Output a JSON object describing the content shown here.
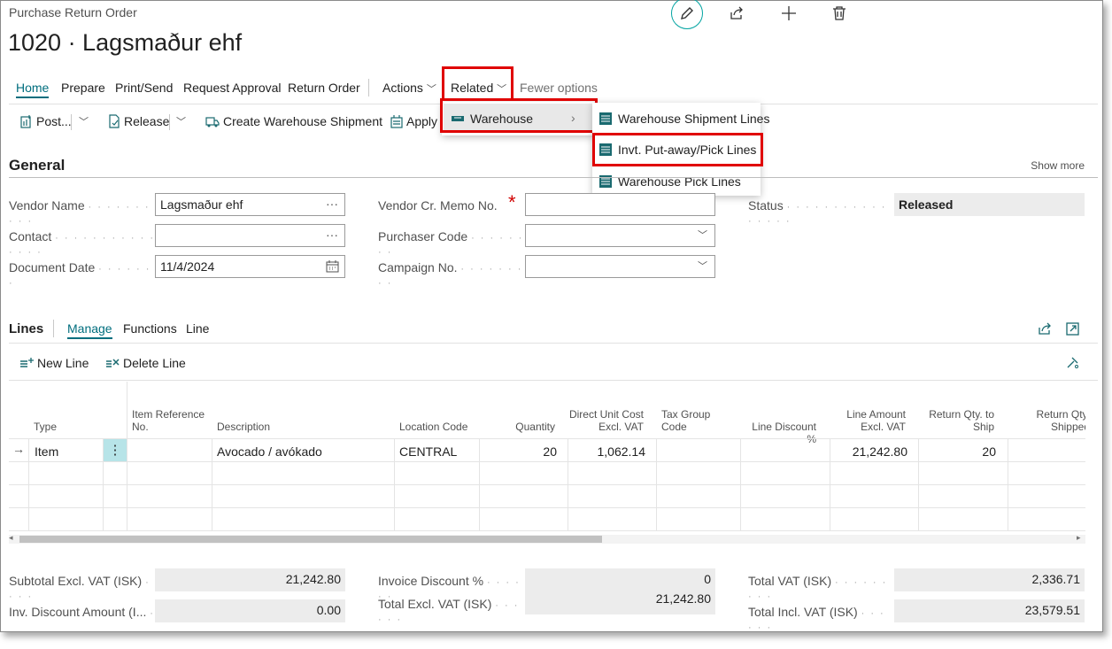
{
  "header": {
    "page_type": "Purchase Return Order",
    "title": "1020 · Lagsmaður ehf"
  },
  "top_icons": [
    "pencil-icon",
    "share-icon",
    "plus-icon",
    "trash-icon"
  ],
  "action_tabs": [
    {
      "label": "Home"
    },
    {
      "label": "Prepare"
    },
    {
      "label": "Print/Send"
    },
    {
      "label": "Request Approval"
    },
    {
      "label": "Return Order"
    },
    {
      "label": "Actions"
    },
    {
      "label": "Related"
    },
    {
      "label": "Fewer options"
    }
  ],
  "toolbar": {
    "post": "Post...",
    "release": "Release",
    "create_ws": "Create Warehouse Shipment",
    "apply": "Apply"
  },
  "related_menu": {
    "warehouse": "Warehouse",
    "sub": [
      "Warehouse Shipment Lines",
      "Invt. Put-away/Pick Lines",
      "Warehouse Pick Lines"
    ]
  },
  "general": {
    "title": "General",
    "show_more": "Show more",
    "vendor_name_label": "Vendor Name",
    "vendor_name": "Lagsmaður ehf",
    "contact_label": "Contact",
    "contact": "",
    "doc_date_label": "Document Date",
    "doc_date": "11/4/2024",
    "cr_memo_label": "Vendor Cr. Memo No.",
    "required_mark": "*",
    "purchaser_label": "Purchaser Code",
    "campaign_label": "Campaign No.",
    "status_label": "Status",
    "status": "Released"
  },
  "lines": {
    "title": "Lines",
    "tabs": [
      "Manage",
      "Functions",
      "Line"
    ],
    "new_line": "New Line",
    "delete_line": "Delete Line",
    "columns": [
      "Type",
      "Item Reference No.",
      "Description",
      "Location Code",
      "Quantity",
      "Direct Unit Cost Excl. VAT",
      "Tax Group Code",
      "Line Discount %",
      "Line Amount Excl. VAT",
      "Return Qty. to Ship",
      "Return Qty. Shipped"
    ],
    "row": {
      "type": "Item",
      "description": "Avocado / avókado",
      "location": "CENTRAL",
      "quantity": "20",
      "unit_cost": "1,062.14",
      "line_amount": "21,242.80",
      "return_qty": "20"
    }
  },
  "totals": {
    "subtotal_label": "Subtotal Excl. VAT (ISK)",
    "subtotal": "21,242.80",
    "inv_disc_amt_label": "Inv. Discount Amount (I...",
    "inv_disc_amt": "0.00",
    "inv_disc_pct_label": "Invoice Discount %",
    "inv_disc_pct": "0",
    "total_excl_label": "Total Excl. VAT (ISK)",
    "total_excl": "21,242.80",
    "total_vat_label": "Total VAT (ISK)",
    "total_vat": "2,336.71",
    "total_incl_label": "Total Incl. VAT (ISK)",
    "total_incl": "23,579.51"
  },
  "colors": {
    "accent": "#006e7e",
    "highlight": "#e00000",
    "selected_cell": "#b7e4e8"
  }
}
